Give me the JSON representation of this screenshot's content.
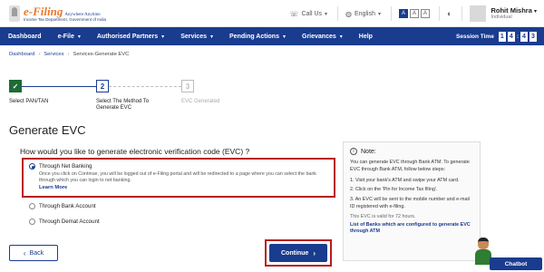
{
  "header": {
    "logo_title": "e-Filing",
    "logo_tagline": "Anywhere Anytime",
    "logo_subtitle": "Income Tax Department, Government of India",
    "call_us": "Call Us",
    "language": "English",
    "font_sizes": [
      "A",
      "A",
      "A"
    ],
    "user_name": "Rohit Mishra",
    "user_role": "Individual"
  },
  "nav": {
    "items": [
      "Dashboard",
      "e-File",
      "Authorised Partners",
      "Services",
      "Pending Actions",
      "Grievances",
      "Help"
    ],
    "session_label": "Session Time",
    "session_digits": [
      "1",
      "4",
      "4",
      "3"
    ]
  },
  "breadcrumb": [
    "Dashboard",
    "Services",
    "Services-Generate EVC"
  ],
  "stepper": {
    "steps": [
      {
        "number": "✓",
        "label": "Select PAN/TAN",
        "status": "completed"
      },
      {
        "number": "2",
        "label": "Select The Method To Generate EVC",
        "status": "current"
      },
      {
        "number": "3",
        "label": "EVC Generated",
        "status": "pending"
      }
    ]
  },
  "page_title": "Generate EVC",
  "question": "How would you like to generate electronic verification code (EVC) ?",
  "options": [
    {
      "label": "Through Net Banking",
      "selected": true,
      "description": "Once you click on Continue, you will be logged out of e-Filing portal and will be redirected to a page where you can select the bank through which you can login to net banking.",
      "link": "Learn More"
    },
    {
      "label": "Through Bank Account",
      "selected": false
    },
    {
      "label": "Through Demat Account",
      "selected": false
    }
  ],
  "note": {
    "title": "Note:",
    "intro": "You can generate EVC through Bank ATM. To generate EVC through Bank ATM, follow below steps:",
    "steps": [
      "1. Visit your bank's ATM and swipe your ATM card.",
      "2. Click on the 'Pin for Income Tax filing'.",
      "3. An EVC will be sent to the mobile number and e-mail ID registered with e-filing."
    ],
    "validity": "This EVC is valid for 72 hours.",
    "link": "List of Banks which are configured to generate EVC through ATM"
  },
  "buttons": {
    "back": "Back",
    "continue": "Continue"
  },
  "chatbot": "Chatbot",
  "icons": {
    "call": "phone-icon",
    "language": "globe-icon",
    "contrast": "contrast-icon",
    "info": "info-icon"
  },
  "colors": {
    "primary": "#1a3c8f",
    "highlight": "#b71c1c",
    "completed": "#1e6b36",
    "logo": "#e9782a"
  }
}
